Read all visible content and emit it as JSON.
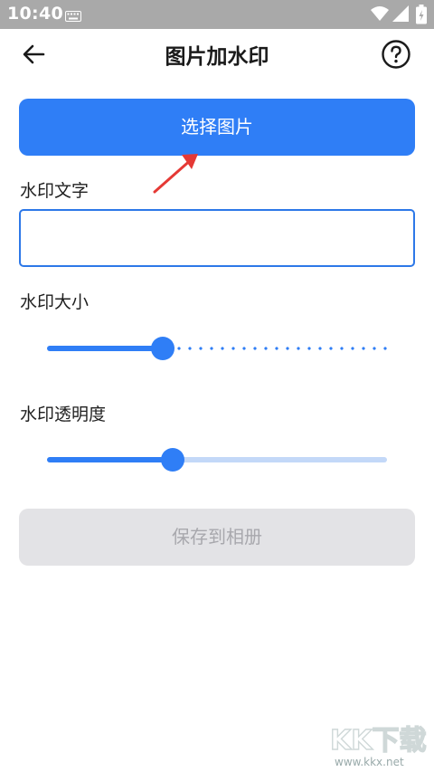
{
  "status_bar": {
    "time": "10:40",
    "icons": [
      "keyboard-icon",
      "wifi-icon",
      "signal-icon",
      "battery-icon"
    ]
  },
  "header": {
    "title": "图片加水印",
    "back_icon": "back-arrow-icon",
    "help_icon": "help-icon"
  },
  "select_button": {
    "label": "选择图片"
  },
  "watermark_text": {
    "label": "水印文字",
    "value": ""
  },
  "watermark_size": {
    "label": "水印大小",
    "level": 0.34
  },
  "watermark_opacity": {
    "label": "水印透明度",
    "level": 0.37
  },
  "save_button": {
    "label": "保存到相册",
    "enabled": false
  },
  "site_watermark": {
    "logo": "KK下载",
    "url": "www.kkx.net"
  },
  "colors": {
    "primary": "#2f7ef6",
    "disabled_bg": "#e3e3e6",
    "disabled_text": "#a8a8ad",
    "status_bar": "#a9a9a9",
    "annotation_arrow": "#e53935"
  }
}
